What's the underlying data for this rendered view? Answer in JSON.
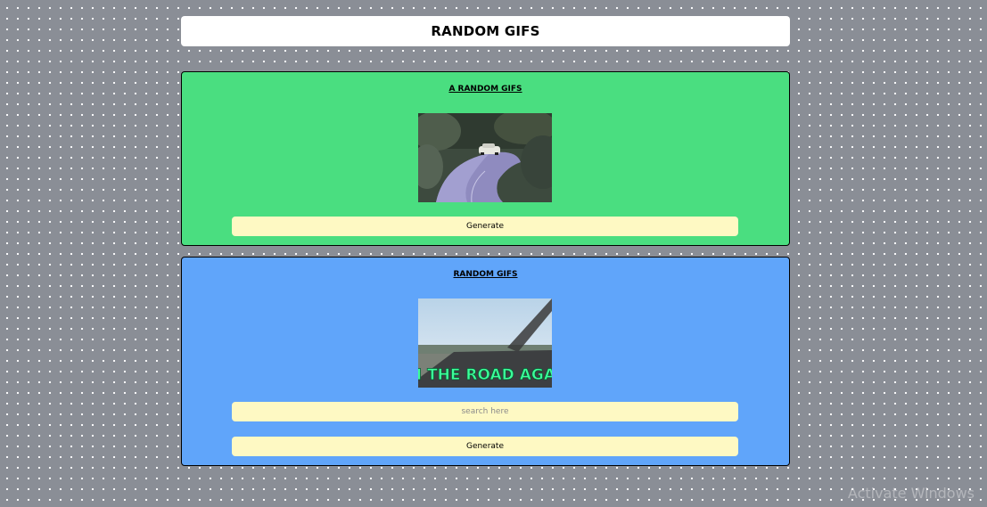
{
  "header": {
    "title": "RANDOM GIFS"
  },
  "random_card": {
    "title": "A RANDOM GIFS",
    "generate_label": "Generate",
    "background": "#4ade80"
  },
  "search_card": {
    "title": "RANDOM GIFS",
    "search_placeholder": "search here",
    "search_value": "",
    "gif_caption": "ON THE ROAD AGAIN",
    "generate_label": "Generate",
    "background": "#60a5fa"
  },
  "colors": {
    "page_background": "#8a8e96",
    "button_background": "#fef9c3",
    "caption_green": "#3cff9a"
  },
  "os_overlay": {
    "watermark": "Activate Windows"
  }
}
